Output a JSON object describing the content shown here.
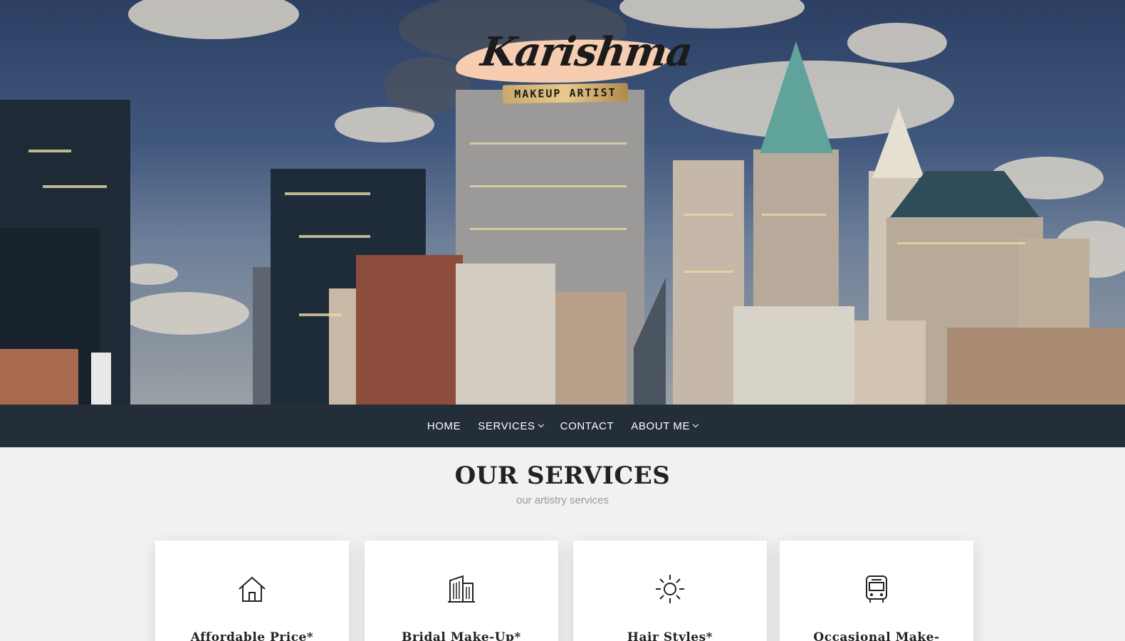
{
  "hero": {
    "logo": {
      "script": "Karishma",
      "tagline": "MAKEUP ARTIST"
    }
  },
  "nav": {
    "items": [
      {
        "label": "HOME",
        "dropdown": false
      },
      {
        "label": "SERVICES",
        "dropdown": true
      },
      {
        "label": "CONTACT",
        "dropdown": false
      },
      {
        "label": "ABOUT ME",
        "dropdown": true
      }
    ]
  },
  "services": {
    "title": "OUR SERVICES",
    "subtitle": "our artistry services",
    "cards": [
      {
        "title": "Affordable Price*",
        "icon": "home-icon"
      },
      {
        "title": "Bridal Make-Up*",
        "icon": "building-icon"
      },
      {
        "title": "Hair Styles*",
        "icon": "sun-icon"
      },
      {
        "title": "Occasional Make-",
        "icon": "bus-icon"
      }
    ]
  },
  "colors": {
    "nav_bg": "#232e39",
    "page_bg": "#f1f1f1",
    "logo_brush": "#f6cdb0"
  }
}
